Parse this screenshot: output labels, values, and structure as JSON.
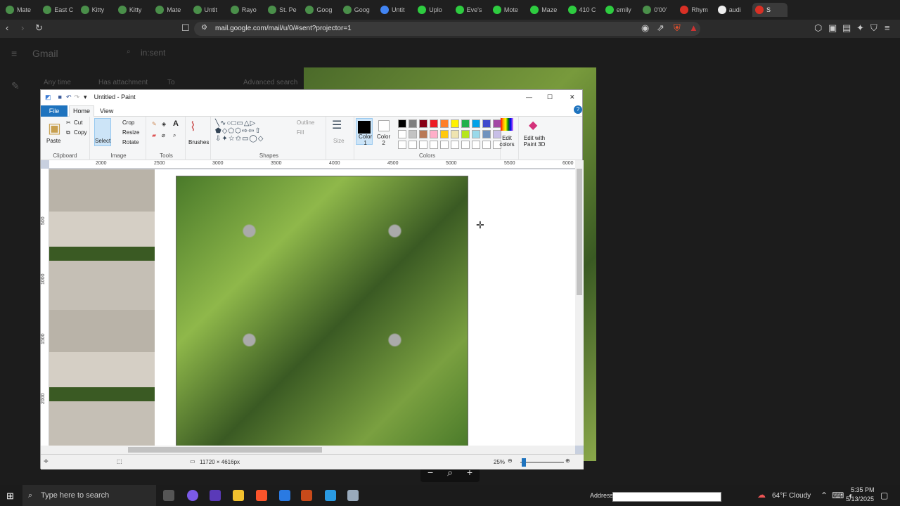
{
  "browser": {
    "tabs": [
      {
        "label": "Mate",
        "color": "#4a8f4a"
      },
      {
        "label": "East C",
        "color": "#4a8f4a"
      },
      {
        "label": "Kitty",
        "color": "#4a8f4a"
      },
      {
        "label": "Kitty",
        "color": "#4a8f4a"
      },
      {
        "label": "Mate",
        "color": "#4a8f4a"
      },
      {
        "label": "Untit",
        "color": "#4a8f4a"
      },
      {
        "label": "Rayo",
        "color": "#4a8f4a"
      },
      {
        "label": "St. Pe",
        "color": "#4a8f4a"
      },
      {
        "label": "Goog",
        "color": "#4a8f4a"
      },
      {
        "label": "Goog",
        "color": "#4a8f4a"
      },
      {
        "label": "Untit",
        "color": "#4285f4"
      },
      {
        "label": "Uplo",
        "color": "#2ecc40"
      },
      {
        "label": "Eve's",
        "color": "#2ecc40"
      },
      {
        "label": "Mote",
        "color": "#2ecc40"
      },
      {
        "label": "Maze",
        "color": "#2ecc40"
      },
      {
        "label": "410 C",
        "color": "#2ecc40"
      },
      {
        "label": "emily",
        "color": "#2ecc40"
      },
      {
        "label": "0'00'",
        "color": "#4a8f4a"
      },
      {
        "label": "Rhym",
        "color": "#d93025"
      },
      {
        "label": "audi",
        "color": "#eeeeee"
      },
      {
        "label": "S",
        "color": "#d93025"
      }
    ],
    "url": "mail.google.com/mail/u/0/#sent?projector=1"
  },
  "gmail": {
    "logo": "Gmail",
    "search": "in:sent",
    "chips": [
      "Any time",
      "Has attachment",
      "To",
      "Advanced search"
    ],
    "rows": [
      "...",
      "...",
      "...",
      "...",
      "...",
      "...",
      "..."
    ]
  },
  "paint": {
    "title": "Untitled - Paint",
    "tabs": {
      "file": "File",
      "home": "Home",
      "view": "View"
    },
    "clipboard": {
      "paste": "Paste",
      "cut": "Cut",
      "copy": "Copy",
      "label": "Clipboard"
    },
    "image": {
      "select": "Select",
      "crop": "Crop",
      "resize": "Resize",
      "rotate": "Rotate",
      "label": "Image"
    },
    "tools": {
      "label": "Tools"
    },
    "brushes": "Brushes",
    "shapes": {
      "outline": "Outline",
      "fill": "Fill",
      "label": "Shapes"
    },
    "size": "Size",
    "color1": "Color\n1",
    "color2": "Color\n2",
    "colors_label": "Colors",
    "edit_colors": "Edit colors",
    "edit_3d": "Edit with Paint 3D",
    "ruler_h": [
      "2000",
      "2500",
      "3000",
      "3500",
      "4000",
      "4500",
      "5000",
      "5500",
      "6000"
    ],
    "ruler_v": [
      "500",
      "1000",
      "1500",
      "2000"
    ],
    "dimensions": "11720 × 4616px",
    "zoom": "25%",
    "palette": [
      "#000000",
      "#7f7f7f",
      "#880015",
      "#ed1c24",
      "#ff7f27",
      "#fff200",
      "#22b14c",
      "#00a2e8",
      "#3f48cc",
      "#a349a4",
      "#ffffff",
      "#c3c3c3",
      "#b97a57",
      "#ffaec9",
      "#ffc90e",
      "#efe4b0",
      "#b5e61d",
      "#99d9ea",
      "#7092be",
      "#c8bfe7"
    ]
  },
  "taskbar": {
    "search_placeholder": "Type here to search",
    "address_label": "Address",
    "weather": "64°F Cloudy",
    "time": "5:35 PM",
    "date": "5/13/2025"
  }
}
